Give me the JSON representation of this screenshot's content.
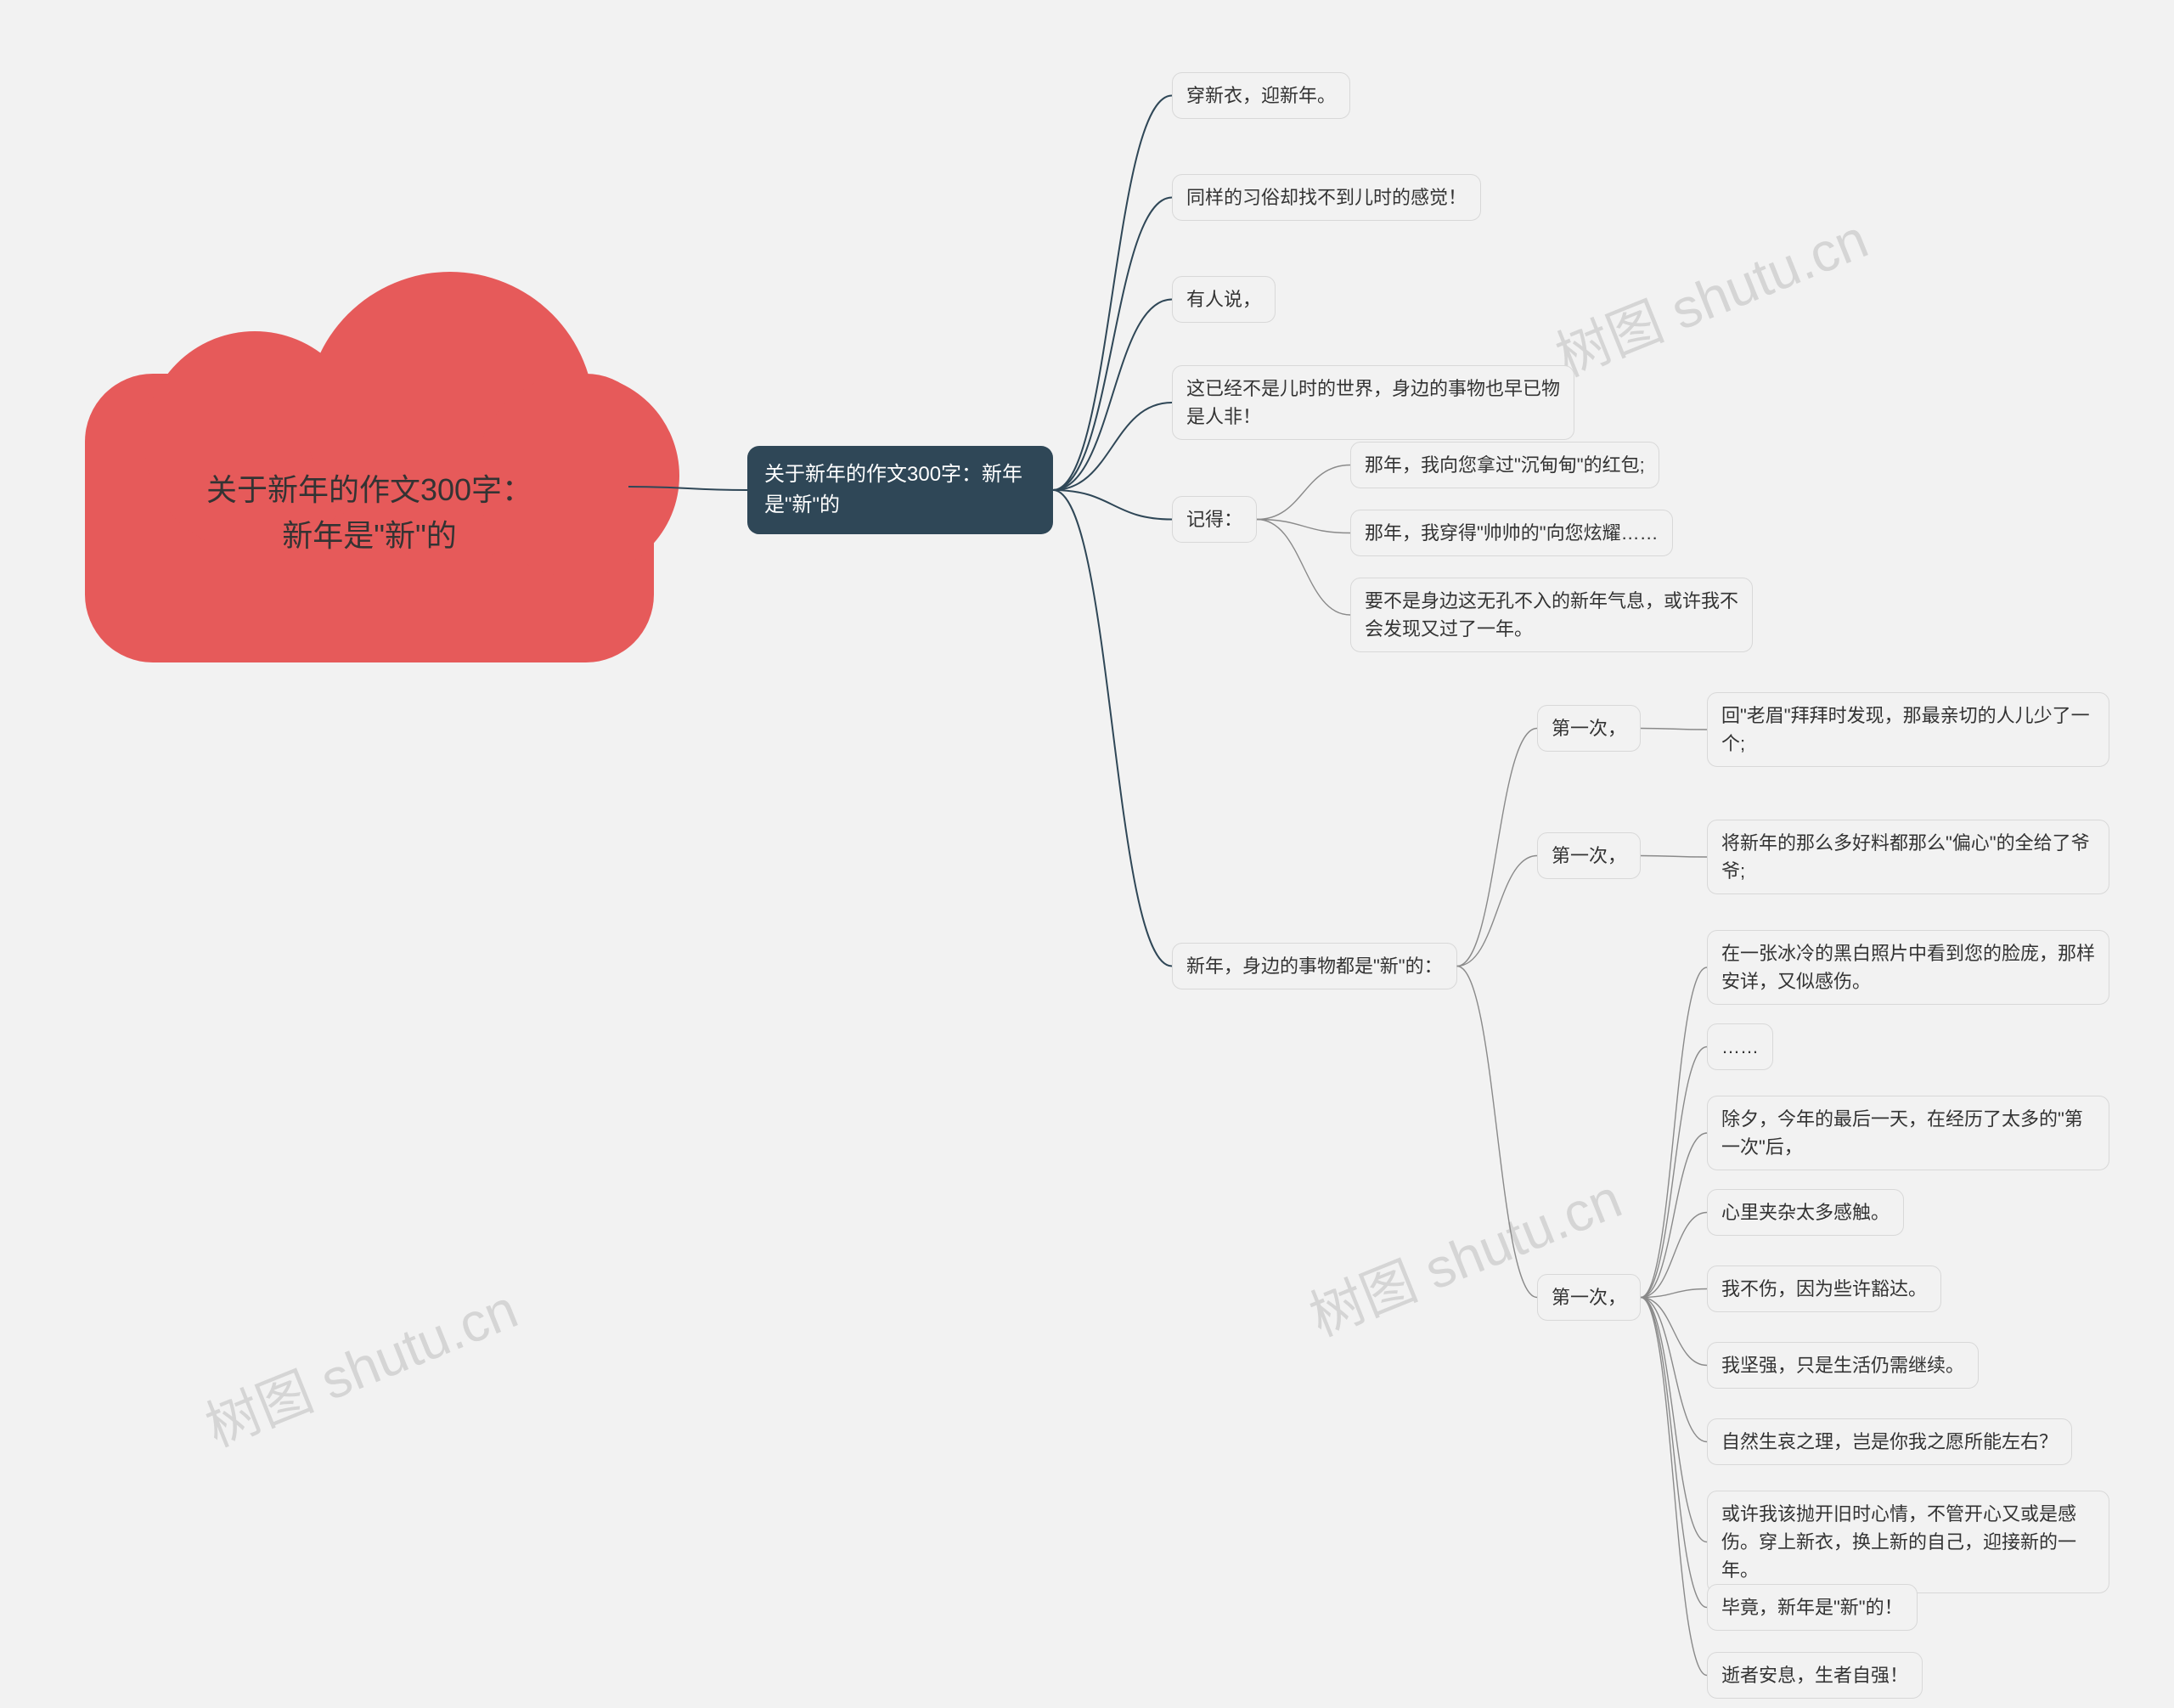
{
  "root": {
    "title_line1": "关于新年的作文300字：",
    "title_line2": "新年是\"新\"的"
  },
  "center": {
    "label": "关于新年的作文300字：新年是\"新\"的"
  },
  "b1": [
    "穿新衣，迎新年。",
    "同样的习俗却找不到儿时的感觉！",
    "有人说，",
    "这已经不是儿时的世界，身边的事物也早已物是人非！"
  ],
  "jide": {
    "label": "记得："
  },
  "jide_children": [
    "那年，我向您拿过\"沉甸甸\"的红包;",
    "那年，我穿得\"帅帅的\"向您炫耀……",
    "要不是身边这无孔不入的新年气息，或许我不会发现又过了一年。"
  ],
  "xin": {
    "label": "新年，身边的事物都是\"新\"的："
  },
  "firsts": {
    "a": {
      "label": "第一次，",
      "child": "回\"老眉\"拜拜时发现，那最亲切的人儿少了一个;"
    },
    "b": {
      "label": "第一次，",
      "child": "将新年的那么多好料都那么\"偏心\"的全给了爷爷;"
    },
    "c": {
      "label": "第一次，",
      "children": [
        "在一张冰冷的黑白照片中看到您的脸庞，那样安详，又似感伤。",
        "……",
        "除夕，今年的最后一天，在经历了太多的\"第一次\"后，",
        "心里夹杂太多感触。",
        "我不伤，因为些许豁达。",
        "我坚强，只是生活仍需继续。",
        "自然生哀之理，岂是你我之愿所能左右？",
        "或许我该抛开旧时心情，不管开心又或是感伤。穿上新衣，换上新的自己，迎接新的一年。",
        "毕竟，新年是\"新\"的！",
        "逝者安息，生者自强！"
      ]
    }
  },
  "watermarks": [
    "树图 shutu.cn",
    "树图 shutu.cn",
    "树图 shutu.cn",
    "树图 shutu.cn"
  ]
}
